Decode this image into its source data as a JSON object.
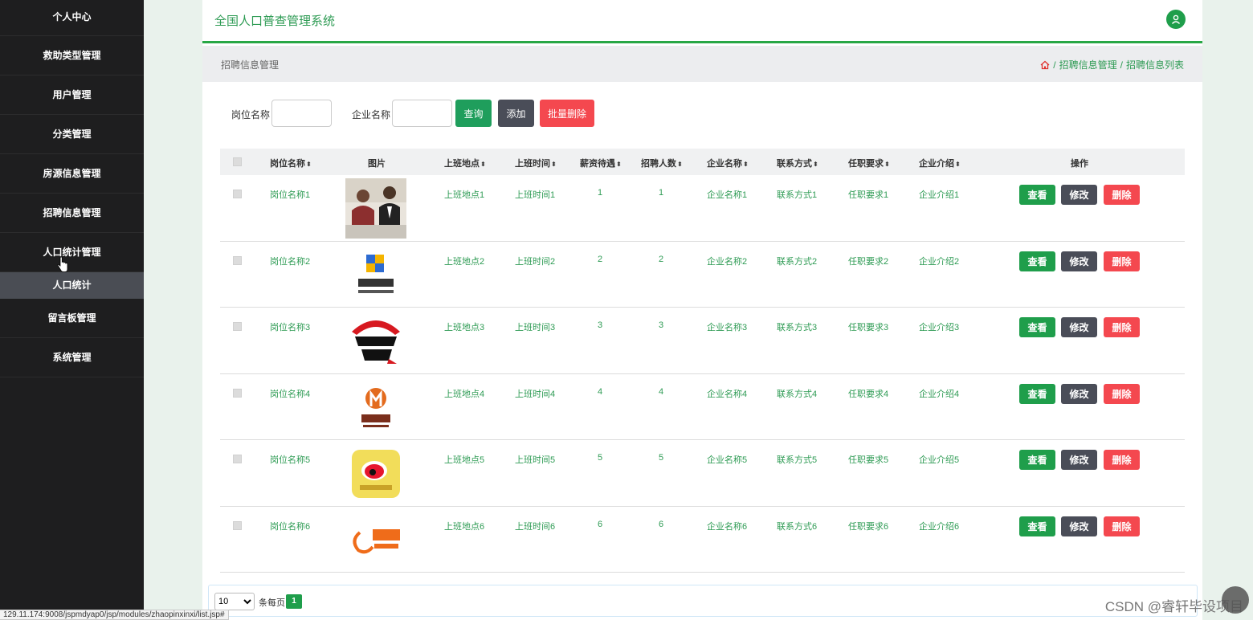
{
  "sidebar": {
    "items": [
      {
        "label": "个人中心"
      },
      {
        "label": "救助类型管理"
      },
      {
        "label": "用户管理"
      },
      {
        "label": "分类管理"
      },
      {
        "label": "房源信息管理"
      },
      {
        "label": "招聘信息管理"
      },
      {
        "label": "人口统计管理"
      }
    ],
    "sub_item": "人口统计",
    "items_after": [
      {
        "label": "留言板管理"
      },
      {
        "label": "系统管理"
      }
    ]
  },
  "header": {
    "title": "全国人口普查管理系统",
    "avatar_icon": "user-icon"
  },
  "breadcrumb": {
    "page_label": "招聘信息管理",
    "trail": [
      "招聘信息管理",
      "招聘信息列表"
    ],
    "separator": "/",
    "home_icon": "home-icon"
  },
  "search": {
    "position_label": "岗位名称",
    "position_value": "",
    "company_label": "企业名称",
    "company_value": "",
    "query_label": "查询",
    "add_label": "添加",
    "batch_delete_label": "批量删除"
  },
  "table": {
    "columns": [
      "岗位名称",
      "图片",
      "上班地点",
      "上班时间",
      "薪资待遇",
      "招聘人数",
      "企业名称",
      "联系方式",
      "任职要求",
      "企业介绍",
      "操作"
    ],
    "sort_icon": "⬍",
    "rows": [
      {
        "position": "岗位名称1",
        "image": "office-meeting",
        "location": "上班地点1",
        "time": "上班时间1",
        "salary": "1",
        "count": "1",
        "company": "企业名称1",
        "contact": "联系方式1",
        "requirement": "任职要求1",
        "intro": "企业介绍1"
      },
      {
        "position": "岗位名称2",
        "image": "jishiwangluo-logo",
        "location": "上班地点2",
        "time": "上班时间2",
        "salary": "2",
        "count": "2",
        "company": "企业名称2",
        "contact": "联系方式2",
        "requirement": "任职要求2",
        "intro": "企业介绍2"
      },
      {
        "position": "岗位名称3",
        "image": "pizza-hut-logo",
        "location": "上班地点3",
        "time": "上班时间3",
        "salary": "3",
        "count": "3",
        "company": "企业名称3",
        "contact": "联系方式3",
        "requirement": "任职要求3",
        "intro": "企业介绍3"
      },
      {
        "position": "岗位名称4",
        "image": "decoration-logo",
        "location": "上班地点4",
        "time": "上班时间4",
        "salary": "4",
        "count": "4",
        "company": "企业名称4",
        "contact": "联系方式4",
        "requirement": "任职要求4",
        "intro": "企业介绍4"
      },
      {
        "position": "岗位名称5",
        "image": "weibo-logo",
        "location": "上班地点5",
        "time": "上班时间5",
        "salary": "5",
        "count": "5",
        "company": "企业名称5",
        "contact": "联系方式5",
        "requirement": "任职要求5",
        "intro": "企业介绍5"
      },
      {
        "position": "岗位名称6",
        "image": "alibaba-logo",
        "location": "上班地点6",
        "time": "上班时间6",
        "salary": "6",
        "count": "6",
        "company": "企业名称6",
        "contact": "联系方式6",
        "requirement": "任职要求6",
        "intro": "企业介绍6"
      }
    ],
    "actions": {
      "view": "查看",
      "edit": "修改",
      "delete": "删除"
    }
  },
  "pagination": {
    "page_size": "10",
    "per_page_label": "条每页",
    "current_page": "1"
  },
  "status_url": "129.11.174:9008/jspmdyap0/jsp/modules/zhaopinxinxi/list.jsp#",
  "watermark": "CSDN @睿轩毕设项目",
  "colors": {
    "accent": "#1f9e4b",
    "danger": "#f4484f",
    "dark": "#4a4d58",
    "sidebar": "#1e1e1f"
  }
}
